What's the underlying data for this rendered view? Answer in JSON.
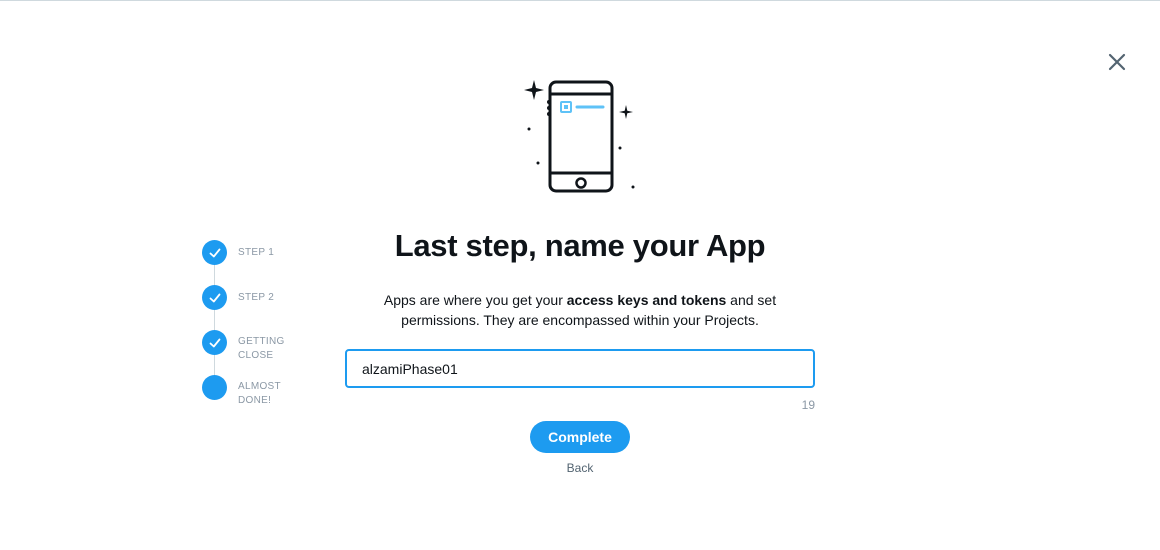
{
  "dialog": {
    "close_icon": "close-icon",
    "illustration_icon": "phone-sparkle-illustration",
    "title": "Last step, name your App",
    "description": {
      "before": "Apps are where you get your ",
      "bold": "access keys and tokens",
      "after": " and set permissions. They are encompassed within your Projects."
    },
    "app_name_value": "alzamiPhase01",
    "char_count": "19",
    "complete_label": "Complete",
    "back_label": "Back"
  },
  "stepper": {
    "steps": [
      {
        "line1": "STEP 1",
        "line2": "",
        "status": "done"
      },
      {
        "line1": "STEP 2",
        "line2": "",
        "status": "done"
      },
      {
        "line1": "GETTING",
        "line2": "CLOSE",
        "status": "done"
      },
      {
        "line1": "ALMOST",
        "line2": "DONE!",
        "status": "current"
      }
    ]
  },
  "colors": {
    "accent": "#1d9bf0",
    "muted_text": "#8b98a5",
    "illustration_highlight": "#5ec2f7"
  }
}
